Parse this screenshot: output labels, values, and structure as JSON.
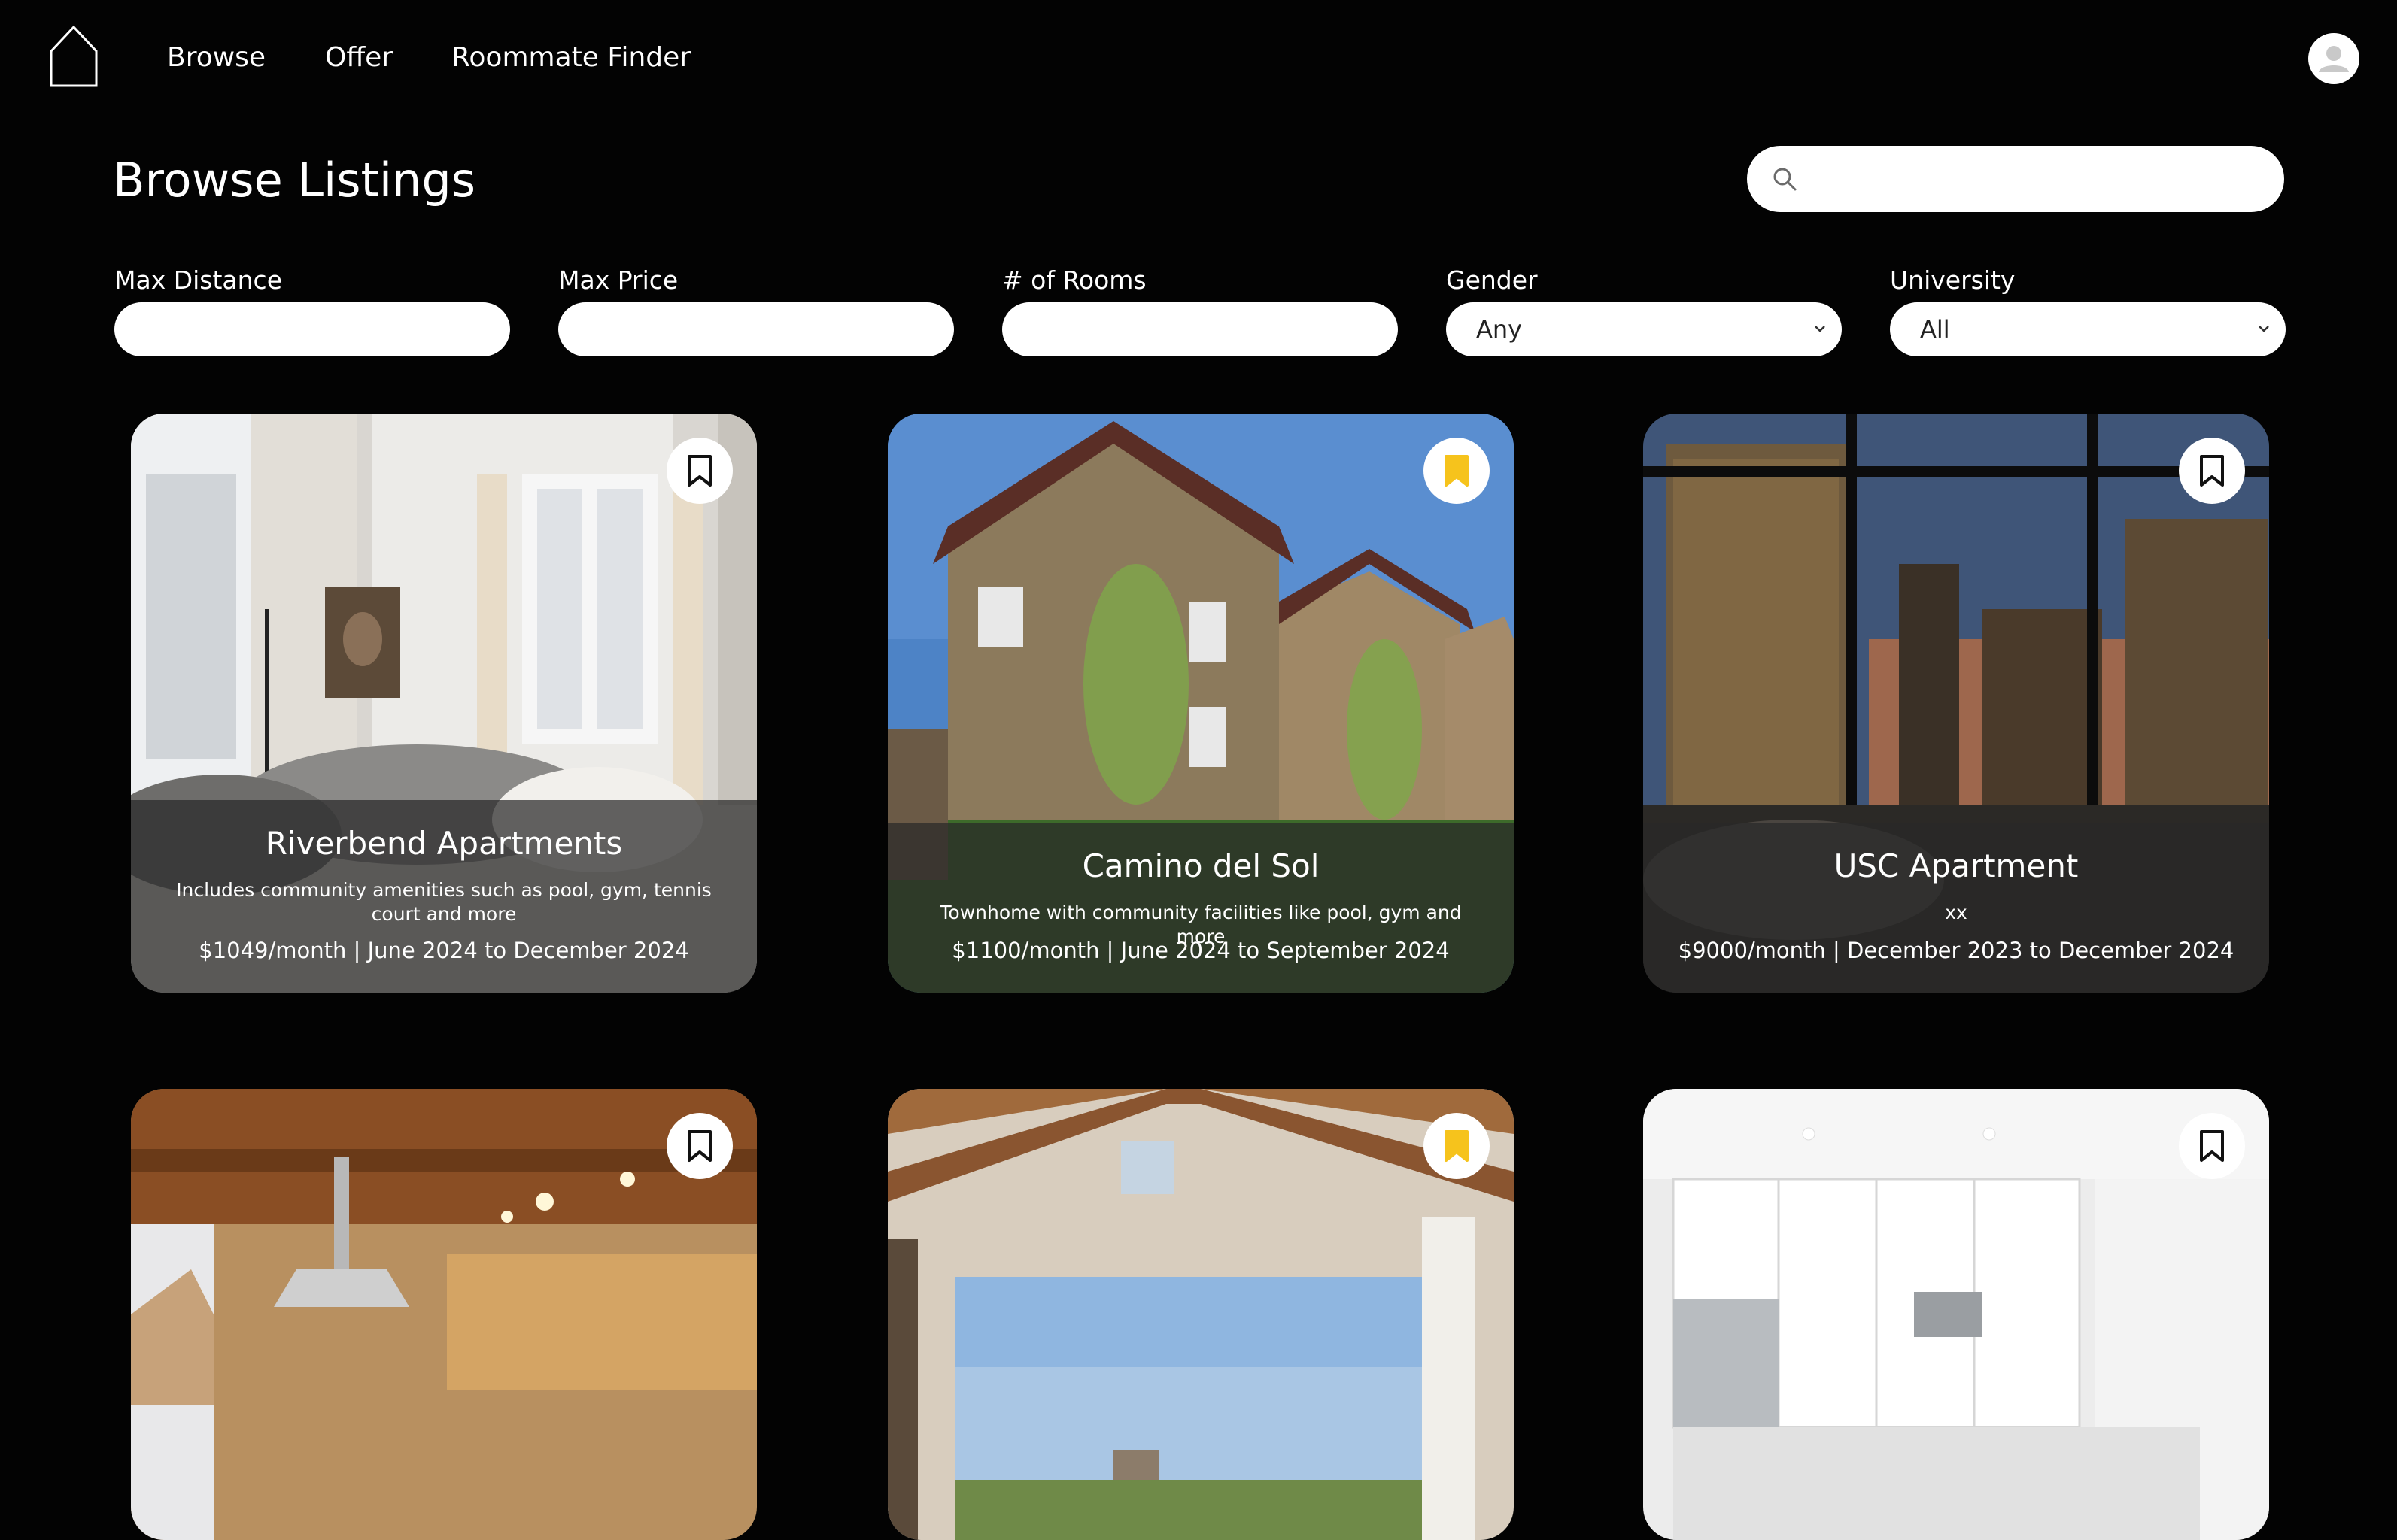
{
  "nav": {
    "links": [
      "Browse",
      "Offer",
      "Roommate Finder"
    ]
  },
  "page": {
    "title": "Browse Listings"
  },
  "search": {
    "placeholder": "",
    "value": ""
  },
  "filters": {
    "max_distance": {
      "label": "Max Distance",
      "value": ""
    },
    "max_price": {
      "label": "Max Price",
      "value": ""
    },
    "rooms": {
      "label": "# of Rooms",
      "value": ""
    },
    "gender": {
      "label": "Gender",
      "selected": "Any"
    },
    "university": {
      "label": "University",
      "selected": "All"
    }
  },
  "colors": {
    "background": "#030303",
    "bookmark_active": "#f6c31c",
    "bookmark_inactive": "#111111"
  },
  "listings": [
    {
      "title": "Riverbend Apartments",
      "description": "Includes community amenities such as pool, gym, tennis court and more",
      "price_dates": "$1049/month | June 2024 to December 2024",
      "saved": false
    },
    {
      "title": "Camino del Sol",
      "description": "Townhome with community facilities like pool, gym and more",
      "price_dates": "$1100/month | June 2024 to September 2024",
      "saved": true
    },
    {
      "title": "USC Apartment",
      "description": "xx",
      "price_dates": "$9000/month | December 2023 to December 2024",
      "saved": false
    },
    {
      "saved": false
    },
    {
      "saved": true
    },
    {
      "saved": false
    }
  ]
}
